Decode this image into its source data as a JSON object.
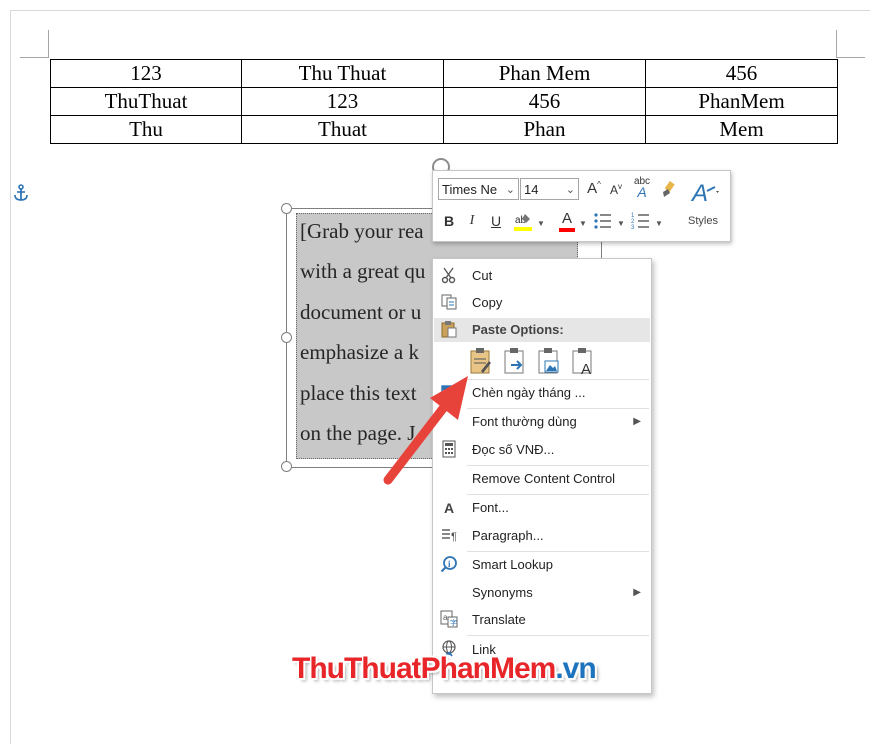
{
  "table": {
    "rows": [
      [
        "123",
        "Thu Thuat",
        "Phan Mem",
        "456"
      ],
      [
        "ThuThuat",
        "123",
        "456",
        "PhanMem"
      ],
      [
        "Thu",
        "Thuat",
        "Phan",
        "Mem"
      ]
    ]
  },
  "textbox": {
    "lines": [
      "[Grab your rea",
      "with a great qu",
      "document or u",
      "emphasize a k",
      "place this text",
      "on the page. J"
    ]
  },
  "mini_toolbar": {
    "font_name": "Times Ne",
    "font_size": "14",
    "grow_font": "A",
    "shrink_font": "A",
    "bold": "B",
    "italic": "I",
    "underline": "U",
    "font_color_letter": "A",
    "styles_label": "Styles"
  },
  "context_menu": {
    "cut": "Cut",
    "copy": "Copy",
    "paste_options": "Paste Options:",
    "insert_date": "Chèn ngày tháng ...",
    "common_fonts": "Font thường dùng",
    "read_vnd": "Đọc số VNĐ...",
    "remove_content_control": "Remove Content Control",
    "font": "Font...",
    "paragraph": "Paragraph...",
    "smart_lookup": "Smart Lookup",
    "synonyms": "Synonyms",
    "translate": "Translate",
    "link": "Link"
  },
  "watermark": {
    "part1": "ThuThuat",
    "part2": "PhanMem",
    "part3": ".vn"
  },
  "colors": {
    "highlight_yellow": "#ffff00",
    "font_red": "#ff0000",
    "arrow_red": "#e8433a",
    "accent_blue": "#2e75b6",
    "watermark_red": "#e8262a",
    "watermark_blue": "#1e73be"
  },
  "icons": [
    "anchor-icon",
    "rotate-handle-icon",
    "scissors-icon",
    "copy-icon",
    "paste-icon",
    "calendar-icon",
    "calculator-icon",
    "font-icon",
    "paragraph-icon",
    "smart-lookup-icon",
    "translate-icon",
    "link-icon",
    "styles-icon",
    "format-painter-icon"
  ]
}
